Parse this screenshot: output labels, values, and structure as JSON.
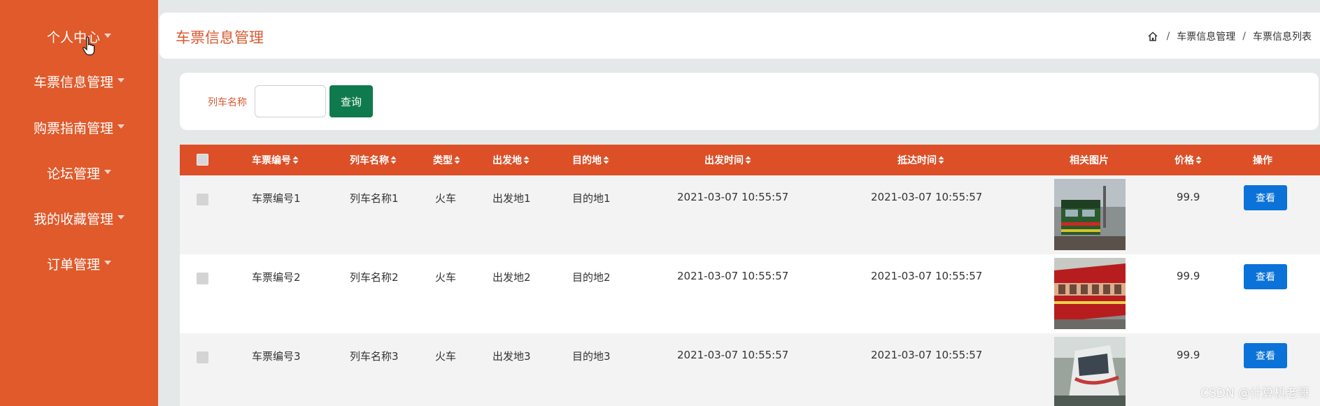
{
  "sidebar": {
    "items": [
      {
        "label": "个人中心"
      },
      {
        "label": "车票信息管理"
      },
      {
        "label": "购票指南管理"
      },
      {
        "label": "论坛管理"
      },
      {
        "label": "我的收藏管理"
      },
      {
        "label": "订单管理"
      }
    ]
  },
  "header": {
    "title": "车票信息管理",
    "breadcrumb": [
      "车票信息管理",
      "车票信息列表"
    ]
  },
  "search": {
    "label": "列车名称",
    "value": "",
    "placeholder": "",
    "button_label": "查询"
  },
  "table": {
    "columns": [
      "车票编号",
      "列车名称",
      "类型",
      "出发地",
      "目的地",
      "出发时间",
      "抵达时间",
      "相关图片",
      "价格",
      "操作"
    ],
    "rows": [
      {
        "ticket_no": "车票编号1",
        "train_name": "列车名称1",
        "type": "火车",
        "from": "出发地1",
        "to": "目的地1",
        "depart": "2021-03-07 10:55:57",
        "arrive": "2021-03-07 10:55:57",
        "price": "99.9",
        "action": "查看"
      },
      {
        "ticket_no": "车票编号2",
        "train_name": "列车名称2",
        "type": "火车",
        "from": "出发地2",
        "to": "目的地2",
        "depart": "2021-03-07 10:55:57",
        "arrive": "2021-03-07 10:55:57",
        "price": "99.9",
        "action": "查看"
      },
      {
        "ticket_no": "车票编号3",
        "train_name": "列车名称3",
        "type": "火车",
        "from": "出发地3",
        "to": "目的地3",
        "depart": "2021-03-07 10:55:57",
        "arrive": "2021-03-07 10:55:57",
        "price": "99.9",
        "action": "查看"
      }
    ]
  },
  "watermark": "CSDN @计算机老哥",
  "colors": {
    "sidebar_bg": "#e05a2b",
    "table_header_bg": "#dc4f27",
    "accent_text": "#d95a32",
    "search_button": "#0f7a4e",
    "view_button": "#0a72d8"
  },
  "icons": [
    "chevron-down-icon",
    "pointer-cursor-icon",
    "home-icon",
    "sort-icon",
    "checkbox-icon",
    "train-image"
  ]
}
